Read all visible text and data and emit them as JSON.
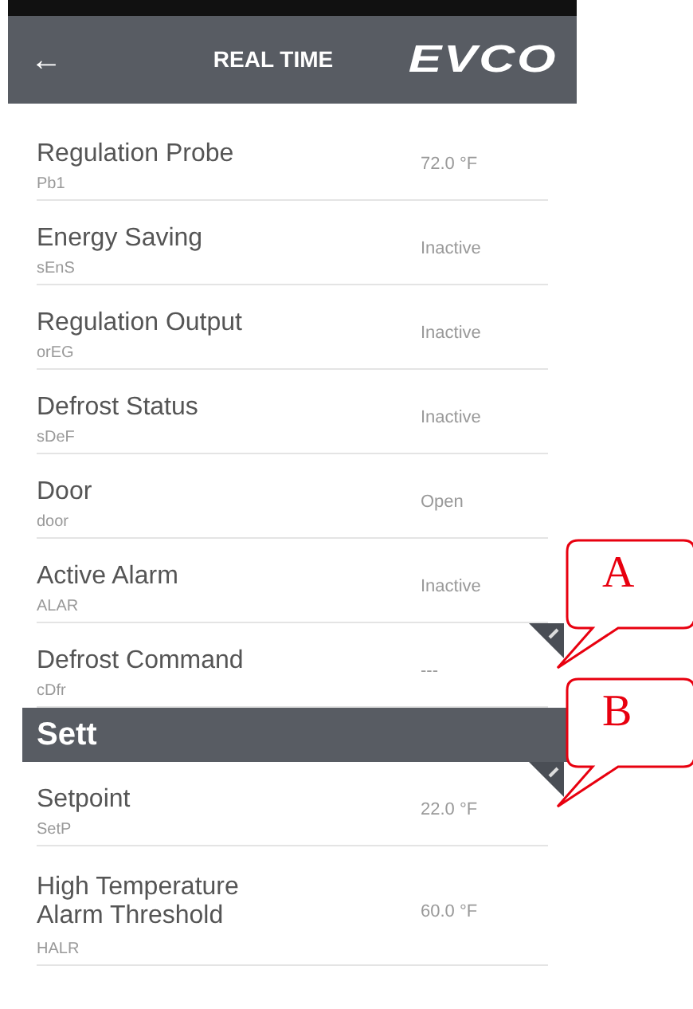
{
  "header": {
    "back": "←",
    "title": "REAL TIME",
    "logo": "EVCO"
  },
  "items": [
    {
      "kind": "row",
      "name": "Regulation Probe",
      "code": "Pb1",
      "value": "72.0 °F",
      "editable": false
    },
    {
      "kind": "row",
      "name": "Energy Saving",
      "code": "sEnS",
      "value": "Inactive",
      "editable": false
    },
    {
      "kind": "row",
      "name": "Regulation Output",
      "code": "orEG",
      "value": "Inactive",
      "editable": false
    },
    {
      "kind": "row",
      "name": "Defrost Status",
      "code": "sDeF",
      "value": "Inactive",
      "editable": false
    },
    {
      "kind": "row",
      "name": "Door",
      "code": "door",
      "value": "Open",
      "editable": false
    },
    {
      "kind": "row",
      "name": "Active Alarm",
      "code": "ALAR",
      "value": "Inactive",
      "editable": false
    },
    {
      "kind": "row",
      "name": "Defrost Command",
      "code": "cDfr",
      "value": "---",
      "editable": true,
      "callout": "A"
    },
    {
      "kind": "section",
      "title": "Sett"
    },
    {
      "kind": "row",
      "name": "Setpoint",
      "code": "SetP",
      "value": "22.0 °F",
      "editable": true,
      "callout": "B"
    },
    {
      "kind": "row",
      "name": "High Temperature Alarm Threshold",
      "code": "HALR",
      "value": "60.0 °F",
      "editable": false
    }
  ]
}
